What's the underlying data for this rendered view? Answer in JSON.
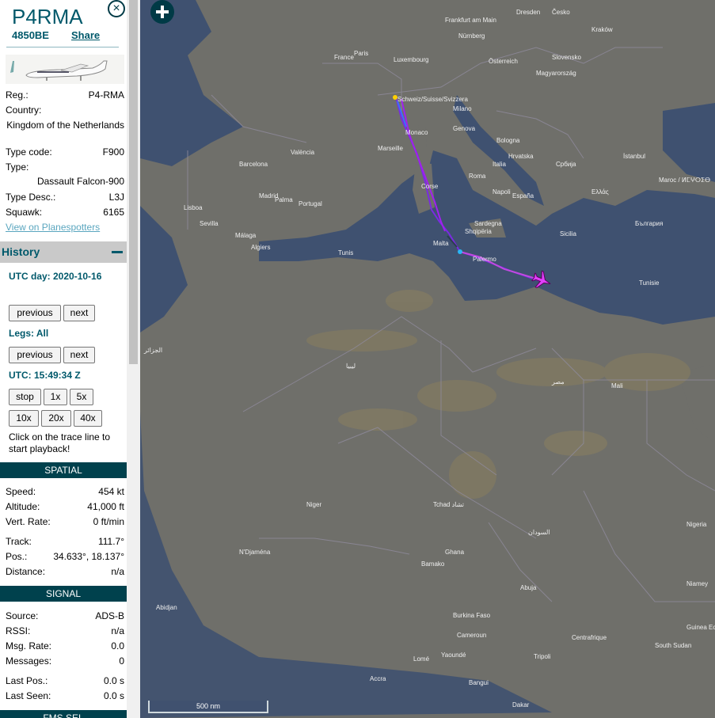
{
  "aircraft": {
    "callsign": "P4RMA",
    "icao": "4850BE",
    "share_label": "Share",
    "close_icon": "close-icon",
    "reg_label": "Reg.:",
    "reg": "P4-RMA",
    "country_label": "Country:",
    "country": "Kingdom of the Netherlands",
    "type_code_label": "Type code:",
    "type_code": "F900",
    "type_label": "Type:",
    "type": "Dassault Falcon-900",
    "type_desc_label": "Type Desc.:",
    "type_desc": "L3J",
    "squawk_label": "Squawk:",
    "squawk": "6165",
    "planespotters_label": "View on Planespotters"
  },
  "history": {
    "title": "History",
    "collapse_icon": "minus-icon",
    "utc_day": "UTC day: 2020-10-16",
    "prev_label": "previous",
    "next_label": "next",
    "legs": "Legs: All",
    "utc_time": "UTC: 15:49:34 Z",
    "stop": "stop",
    "x1": "1x",
    "x5": "5x",
    "x10": "10x",
    "x20": "20x",
    "x40": "40x",
    "note": "Click on the trace line to start playback!"
  },
  "spatial": {
    "title": "SPATIAL",
    "speed_label": "Speed:",
    "speed": "454 kt",
    "altitude_label": "Altitude:",
    "altitude": "41,000 ft",
    "vert_rate_label": "Vert. Rate:",
    "vert_rate": "0 ft/min",
    "track_label": "Track:",
    "track": "111.7°",
    "pos_label": "Pos.:",
    "pos": "34.633°, 18.137°",
    "distance_label": "Distance:",
    "distance": "n/a"
  },
  "signal": {
    "title": "SIGNAL",
    "source_label": "Source:",
    "source": "ADS-B",
    "rssi_label": "RSSI:",
    "rssi": "n/a",
    "msg_rate_label": "Msg. Rate:",
    "msg_rate": "0.0",
    "messages_label": "Messages:",
    "messages": "0",
    "last_pos_label": "Last Pos.:",
    "last_pos": "0.0 s",
    "last_seen_label": "Last Seen:",
    "last_seen": "0.0 s"
  },
  "fms": {
    "title": "FMS SEL"
  },
  "map": {
    "zoom_in_icon": "plus-icon",
    "scale": "500 nm",
    "colors": {
      "land": "#6f6f6a",
      "sea": "#3f5170",
      "track": "#a020f0",
      "plane": "#e040fb"
    },
    "labels": [
      {
        "text": "France"
      },
      {
        "text": "Paris"
      },
      {
        "text": "Luxembourg"
      },
      {
        "text": "Frankfurt am Main"
      },
      {
        "text": "Nürnberg"
      },
      {
        "text": "Dresden"
      },
      {
        "text": "Česko"
      },
      {
        "text": "Kraków"
      },
      {
        "text": "Slovensko"
      },
      {
        "text": "Magyarország"
      },
      {
        "text": "Österreich"
      },
      {
        "text": "Schweiz/Suisse/Svizzera"
      },
      {
        "text": "Milano"
      },
      {
        "text": "Genova"
      },
      {
        "text": "Bologna"
      },
      {
        "text": "Hrvatska"
      },
      {
        "text": "Србија"
      },
      {
        "text": "Monaco"
      },
      {
        "text": "Marseille"
      },
      {
        "text": "Italia"
      },
      {
        "text": "Roma"
      },
      {
        "text": "Napoli"
      },
      {
        "text": "España"
      },
      {
        "text": "Madrid"
      },
      {
        "text": "Barcelona"
      },
      {
        "text": "València"
      },
      {
        "text": "Palma"
      },
      {
        "text": "Portugal"
      },
      {
        "text": "Lisboa"
      },
      {
        "text": "Sevilla"
      },
      {
        "text": "Málaga"
      },
      {
        "text": "Algiers"
      },
      {
        "text": "Tunis"
      },
      {
        "text": "Malta"
      },
      {
        "text": "Palermo"
      },
      {
        "text": "Shqipëria"
      },
      {
        "text": "Ελλάς"
      },
      {
        "text": "България"
      },
      {
        "text": "İstanbul"
      },
      {
        "text": "Maroc / ⵍⵎⵖⵔⵉⴱ"
      },
      {
        "text": "الجزائر"
      },
      {
        "text": "ليبيا"
      },
      {
        "text": "مصر"
      },
      {
        "text": "Mali"
      },
      {
        "text": "Niger"
      },
      {
        "text": "Tchad تشاد"
      },
      {
        "text": "السودان"
      },
      {
        "text": "Nigeria"
      },
      {
        "text": "Burkina Faso"
      },
      {
        "text": "Ghana"
      },
      {
        "text": "Cameroun"
      },
      {
        "text": "Niamey"
      },
      {
        "text": "Bamako"
      },
      {
        "text": "N'Djaména"
      },
      {
        "text": "Abuja"
      },
      {
        "text": "Centrafrique"
      },
      {
        "text": "South Sudan"
      },
      {
        "text": "Guinea Ecuatorial"
      },
      {
        "text": "Dakar"
      },
      {
        "text": "Abidjan"
      },
      {
        "text": "Accra"
      },
      {
        "text": "Lomé"
      },
      {
        "text": "Yaoundé"
      },
      {
        "text": "Bangui"
      },
      {
        "text": "Tripoli"
      },
      {
        "text": "Tunisie"
      },
      {
        "text": "Sicilia"
      },
      {
        "text": "Sardegna"
      },
      {
        "text": "Corse"
      }
    ]
  }
}
